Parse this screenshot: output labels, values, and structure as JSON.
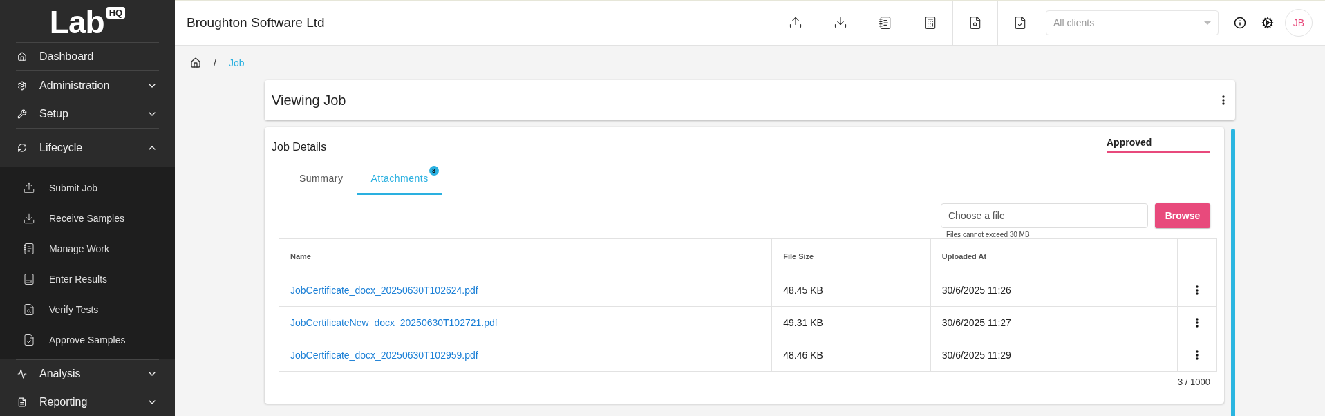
{
  "sidebar": {
    "logo": {
      "text": "Lab",
      "badge": "HQ"
    },
    "items": [
      {
        "label": "Dashboard",
        "kind": "link"
      },
      {
        "label": "Administration",
        "kind": "group",
        "expanded": false
      },
      {
        "label": "Setup",
        "kind": "group",
        "expanded": false
      },
      {
        "label": "Lifecycle",
        "kind": "group",
        "expanded": true,
        "children": [
          {
            "label": "Submit Job"
          },
          {
            "label": "Receive Samples"
          },
          {
            "label": "Manage Work"
          },
          {
            "label": "Enter Results"
          },
          {
            "label": "Verify Tests"
          },
          {
            "label": "Approve Samples"
          }
        ]
      },
      {
        "label": "Analysis",
        "kind": "group",
        "expanded": false
      },
      {
        "label": "Reporting",
        "kind": "group",
        "expanded": false
      }
    ]
  },
  "header": {
    "title": "Broughton Software Ltd",
    "client_select": {
      "placeholder": "All clients"
    },
    "avatar": "JB"
  },
  "breadcrumb": {
    "separator": "/",
    "current": "Job"
  },
  "page_card": {
    "title": "Viewing Job"
  },
  "job_details": {
    "title": "Job Details",
    "status": "Approved",
    "tabs": [
      {
        "label": "Summary",
        "selected": false
      },
      {
        "label": "Attachments",
        "selected": true,
        "badge": "3"
      }
    ],
    "upload": {
      "placeholder": "Choose a file",
      "button": "Browse",
      "hint": "Files cannot exceed 30 MB"
    },
    "table": {
      "columns": [
        "Name",
        "File Size",
        "Uploaded At"
      ],
      "rows": [
        {
          "name": "JobCertificate_docx_20250630T102624.pdf",
          "size": "48.45 KB",
          "uploaded": "30/6/2025 11:26"
        },
        {
          "name": "JobCertificateNew_docx_20250630T102721.pdf",
          "size": "49.31 KB",
          "uploaded": "30/6/2025 11:27"
        },
        {
          "name": "JobCertificate_docx_20250630T102959.pdf",
          "size": "48.46 KB",
          "uploaded": "30/6/2025 11:29"
        }
      ]
    },
    "count": "3 / 1000"
  }
}
